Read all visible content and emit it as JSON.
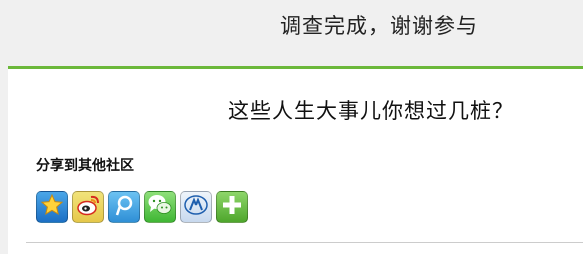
{
  "header": {
    "title": "调查完成，谢谢参与"
  },
  "survey": {
    "title": "这些人生大事儿你想过几桩？"
  },
  "share": {
    "label": "分享到其他社区",
    "buttons": [
      {
        "icon": "qzone-star-icon"
      },
      {
        "icon": "weibo-icon"
      },
      {
        "icon": "tencent-weibo-icon"
      },
      {
        "icon": "wechat-icon"
      },
      {
        "icon": "renren-icon"
      },
      {
        "icon": "plus-icon"
      }
    ]
  },
  "colors": {
    "accent_green": "#6bb83a",
    "banner_bg": "#f0f0f0"
  }
}
